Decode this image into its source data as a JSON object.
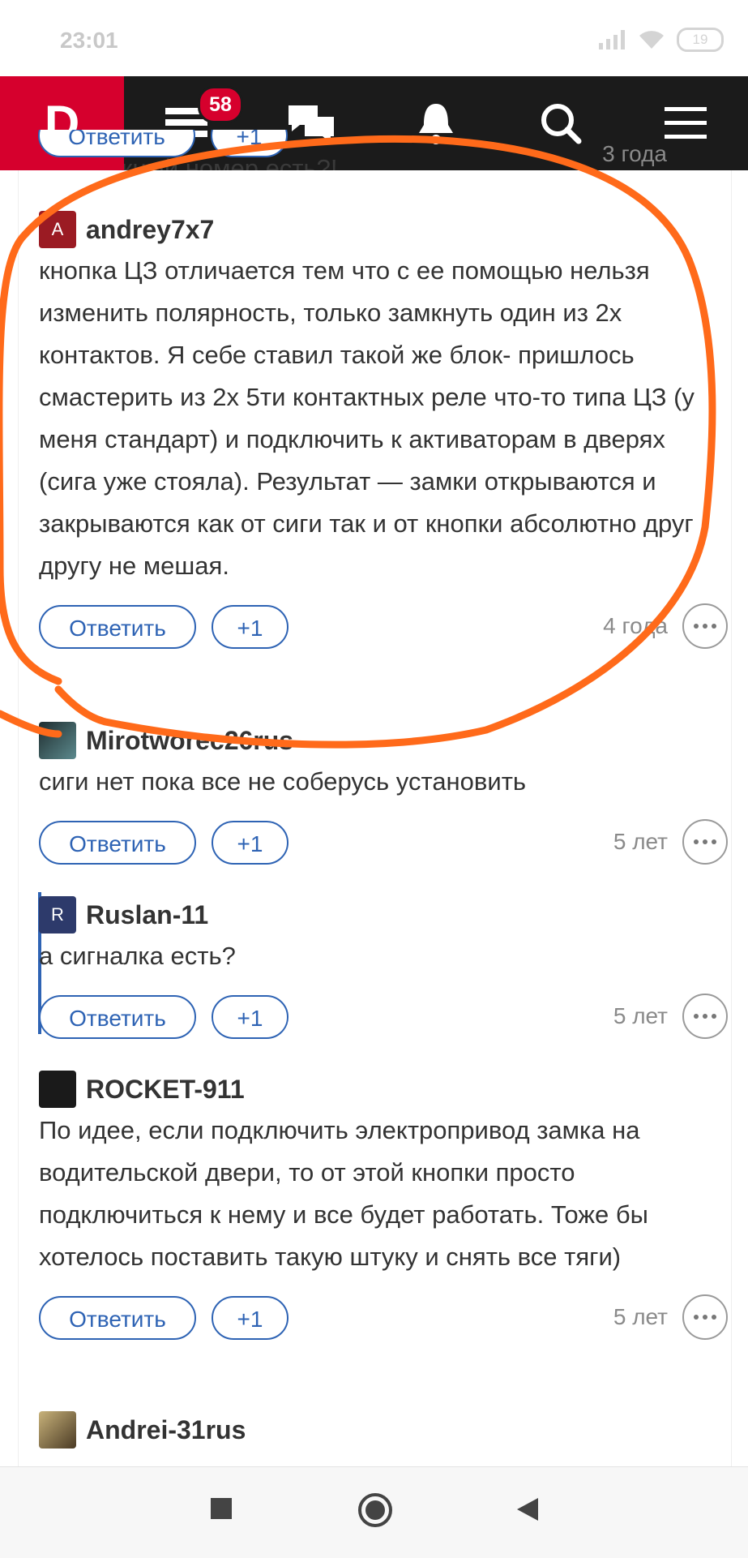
{
  "statusbar": {
    "time": "23:01",
    "battery": "19"
  },
  "header": {
    "logo": "D",
    "badge_count": "58",
    "behind_text": "...ожный номер есть?!"
  },
  "comments": [
    {
      "author": "andrey7x7",
      "avatar_letter": "A",
      "text": "кнопка ЦЗ отличается тем что с ее помощью нельзя изменить полярность, только замкнуть один из 2х контактов. Я себе ставил такой же блок- пришлось смастерить из 2х 5ти контактных реле что-то типа ЦЗ (у меня стандарт) и подключить к активаторам в дверях (сига уже стояла). Результат — замки открываются и закрываются как от сиги так и от кнопки абсолютно друг другу не мешая.",
      "age": "4 года"
    },
    {
      "author": "Mirotworec26rus",
      "avatar_letter": "",
      "text": "сиги нет пока все не соберусь установить",
      "age": "5 лет"
    },
    {
      "author": "Ruslan-11",
      "avatar_letter": "R",
      "text": "а сигналка есть?",
      "age": "5 лет"
    },
    {
      "author": "ROCKET-911",
      "avatar_letter": "",
      "text": "По идее, если подключить электропривод замка на водительской двери, то от этой кнопки просто подключиться к нему и все будет работать. Тоже бы хотелось поставить такую штуку и снять все тяги)",
      "age": "5 лет"
    }
  ],
  "last_author": "Andrei-31rus",
  "prev_comment_age": "3 года",
  "labels": {
    "reply": "Ответить",
    "plus": "+1"
  },
  "colors": {
    "brand": "#d6002d",
    "link": "#2e63b4",
    "header": "#1b1b1b",
    "annotation": "#ff6a1a"
  }
}
